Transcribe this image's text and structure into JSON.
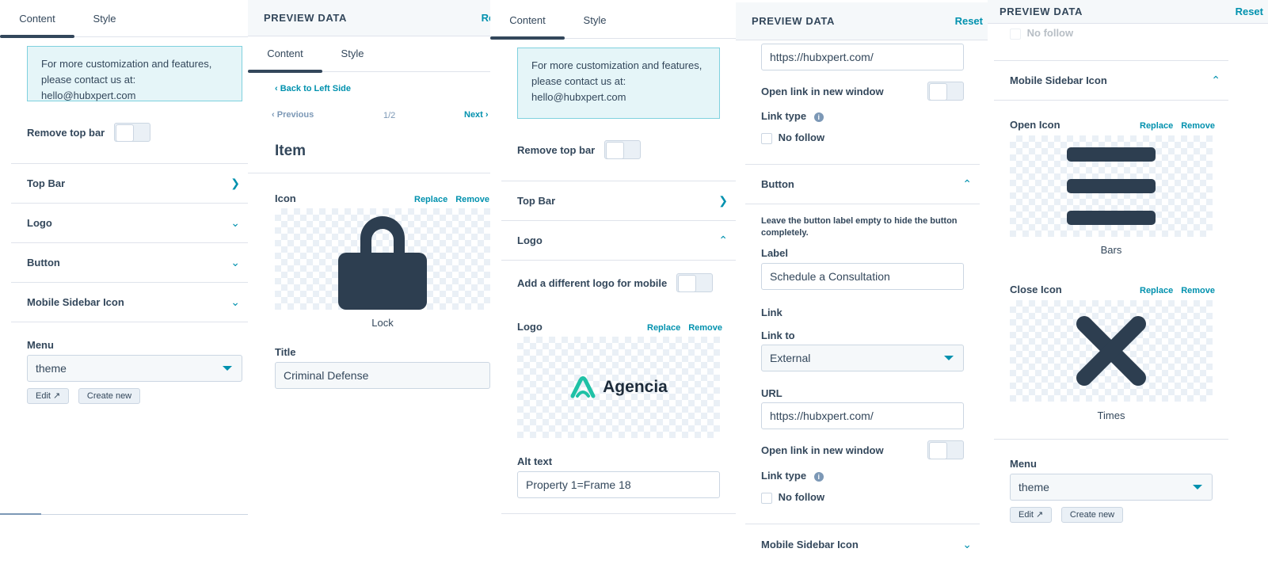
{
  "p1": {
    "tabs": [
      "Content",
      "Style"
    ],
    "notice": "For more customization and features, please contact us at: hello@hubxpert.com",
    "remove_top_bar": "Remove top bar",
    "sections": [
      "Top Bar",
      "Logo",
      "Button",
      "Mobile Sidebar Icon"
    ],
    "menu_label": "Menu",
    "menu_value": "theme",
    "edit": "Edit",
    "create_new": "Create new"
  },
  "p2": {
    "header": "PREVIEW DATA",
    "reset": "Reset",
    "tabs": [
      "Content",
      "Style"
    ],
    "back": "Back to Left Side",
    "previous": "Previous",
    "pager": "1/2",
    "next": "Next",
    "item_title": "Item",
    "icon_label": "Icon",
    "replace": "Replace",
    "remove": "Remove",
    "icon_name": "Lock",
    "title_label": "Title",
    "title_value": "Criminal Defense"
  },
  "p3": {
    "tabs": [
      "Content",
      "Style"
    ],
    "notice": "For more customization and features, please contact us at: hello@hubxpert.com",
    "remove_top_bar": "Remove top bar",
    "top_bar": "Top Bar",
    "logo_section": "Logo",
    "diff_logo": "Add a different logo for mobile",
    "logo_label": "Logo",
    "replace": "Replace",
    "remove": "Remove",
    "logo_text": "Agencia",
    "alt_label": "Alt text",
    "alt_value": "Property 1=Frame 18"
  },
  "p4": {
    "header": "PREVIEW DATA",
    "reset": "Reset",
    "url_top": "https://hubxpert.com/",
    "open_new": "Open link in new window",
    "link_type": "Link type",
    "no_follow": "No follow",
    "button_section": "Button",
    "hint": "Leave the button label empty to hide the button completely.",
    "label_label": "Label",
    "label_value": "Schedule a Consultation",
    "link_heading": "Link",
    "link_to": "Link to",
    "link_to_value": "External",
    "url_label": "URL",
    "url_value": "https://hubxpert.com/",
    "open_new2": "Open link in new window",
    "link_type2": "Link type",
    "no_follow2": "No follow",
    "mobile_sidebar": "Mobile Sidebar Icon"
  },
  "p5": {
    "header": "PREVIEW DATA",
    "reset": "Reset",
    "no_follow": "No follow",
    "section": "Mobile Sidebar Icon",
    "open_icon": "Open Icon",
    "close_icon": "Close Icon",
    "replace": "Replace",
    "remove": "Remove",
    "open_name": "Bars",
    "close_name": "Times",
    "menu_label": "Menu",
    "menu_value": "theme",
    "edit": "Edit",
    "create_new": "Create new"
  },
  "colors": {
    "accent": "#0091ae",
    "text": "#33475b",
    "notice_bg": "#e5f5f8",
    "icon": "#2d3e50"
  }
}
